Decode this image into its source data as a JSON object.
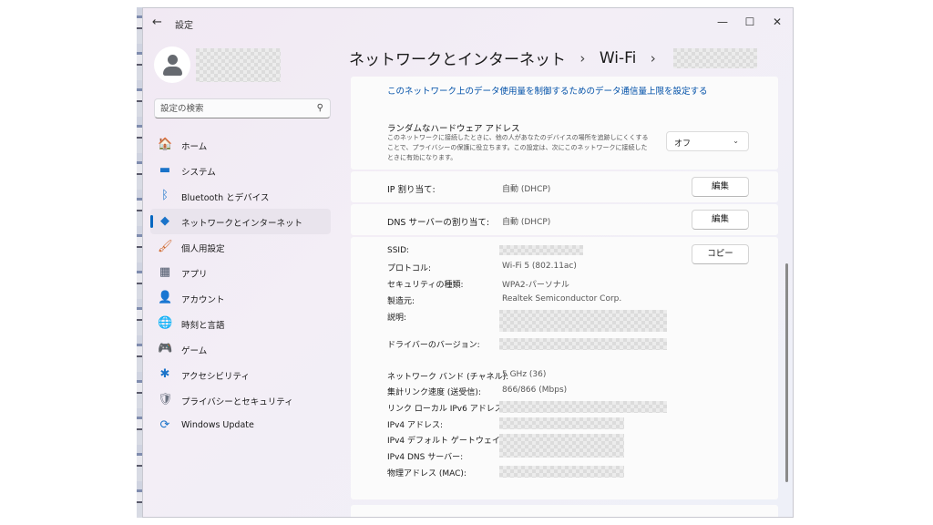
{
  "window": {
    "title": "設定",
    "back": "←",
    "minimize": "—",
    "maximize": "☐",
    "close": "✕"
  },
  "search": {
    "placeholder": "設定の検索",
    "icon": "⚲"
  },
  "sidebar": {
    "items": [
      {
        "name": "home",
        "label": "ホーム",
        "icon": "🏠",
        "active": false
      },
      {
        "name": "system",
        "label": "システム",
        "icon": "▬",
        "active": false
      },
      {
        "name": "bluetooth",
        "label": "Bluetooth とデバイス",
        "icon": "ᛒ",
        "active": false
      },
      {
        "name": "network",
        "label": "ネットワークとインターネット",
        "icon": "◆",
        "active": true
      },
      {
        "name": "personalization",
        "label": "個人用設定",
        "icon": "🖌",
        "active": false
      },
      {
        "name": "apps",
        "label": "アプリ",
        "icon": "▦",
        "active": false
      },
      {
        "name": "accounts",
        "label": "アカウント",
        "icon": "👤",
        "active": false
      },
      {
        "name": "time-language",
        "label": "時刻と言語",
        "icon": "🌐",
        "active": false
      },
      {
        "name": "gaming",
        "label": "ゲーム",
        "icon": "🎮",
        "active": false
      },
      {
        "name": "accessibility",
        "label": "アクセシビリティ",
        "icon": "✱",
        "active": false
      },
      {
        "name": "privacy",
        "label": "プライバシーとセキュリティ",
        "icon": "🛡",
        "active": false
      },
      {
        "name": "windows-update",
        "label": "Windows Update",
        "icon": "⟳",
        "active": false
      }
    ]
  },
  "breadcrumb": {
    "part1": "ネットワークとインターネット",
    "sep": "›",
    "part2": "Wi-Fi"
  },
  "content": {
    "data_limit_link": "このネットワーク上のデータ使用量を制御するためのデータ通信量上限を設定する",
    "random_hw": {
      "title": "ランダムなハードウェア アドレス",
      "desc": "このネットワークに接続したときに、他の人があなたのデバイスの場所を追跡しにくくすることで、プライバシーの保護に役立ちます。この設定は、次にこのネットワークに接続したときに有効になります。",
      "select_value": "オフ",
      "chevron": "⌄"
    },
    "ip": {
      "title": "IP 割り当て:",
      "value": "自動 (DHCP)",
      "button": "編集"
    },
    "dns": {
      "title": "DNS サーバーの割り当て:",
      "value": "自動 (DHCP)",
      "button": "編集"
    },
    "copy_button": "コピー",
    "props": {
      "ssid": "SSID:",
      "protocol": "プロトコル:",
      "protocol_value": "Wi-Fi 5 (802.11ac)",
      "security": "セキュリティの種類:",
      "security_value": "WPA2-パーソナル",
      "manufacturer": "製造元:",
      "manufacturer_value": "Realtek Semiconductor Corp.",
      "description": "説明:",
      "driver": "ドライバーのバージョン:",
      "band": "ネットワーク バンド (チャネル):",
      "band_value": "5 GHz (36)",
      "link_speed": "集計リンク速度 (送受信):",
      "link_speed_value": "866/866 (Mbps)",
      "ipv6": "リンク ローカル IPv6 アドレス:",
      "ipv4": "IPv4 アドレス:",
      "gateway": "IPv4 デフォルト ゲートウェイ:",
      "ipv4_dns": "IPv4 DNS サーバー:",
      "mac": "物理アドレス (MAC):"
    }
  },
  "colors": {
    "accent": "#0067c0",
    "link": "#0050a8"
  }
}
